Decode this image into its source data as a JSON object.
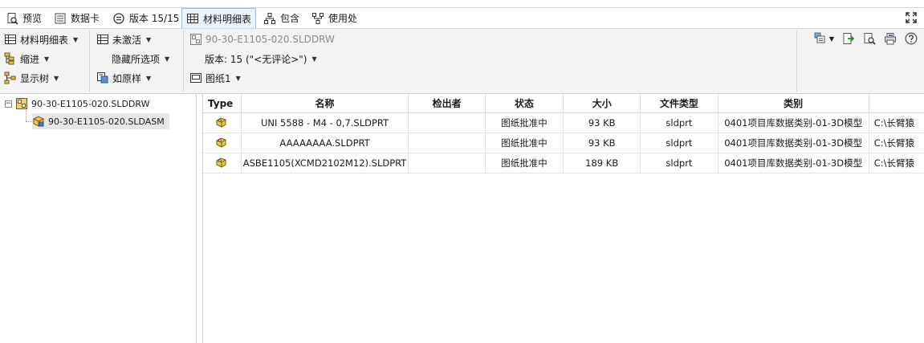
{
  "tabs": [
    {
      "label": "预览",
      "icon": "preview-icon"
    },
    {
      "label": "数据卡",
      "icon": "datacard-icon"
    },
    {
      "label": "版本 15/15",
      "icon": "version-icon"
    },
    {
      "label": "材料明细表",
      "icon": "bom-table-icon",
      "active": true
    },
    {
      "label": "包含",
      "icon": "contains-icon"
    },
    {
      "label": "使用处",
      "icon": "where-used-icon"
    }
  ],
  "toolbar": {
    "bom_label": "材料明细表",
    "indent_label": "缩进",
    "show_tree_label": "显示树",
    "inactive_label": "未激活",
    "hidden_options_label": "隐藏所选项",
    "as_built_label": "如原样",
    "file_name": "90-30-E1105-020.SLDDRW",
    "version_label": "版本: 15 (\"<无评论>\")",
    "sheet_label": "图纸1"
  },
  "tree": {
    "root": "90-30-E1105-020.SLDDRW",
    "child": "90-30-E1105-020.SLDASM"
  },
  "table": {
    "headers": {
      "type": "Type",
      "name": "名称",
      "checked_out_by": "检出者",
      "state": "状态",
      "size": "大小",
      "file_type": "文件类型",
      "category": "类别"
    },
    "rows": [
      {
        "name": "UNI 5588 - M4 - 0,7.SLDPRT",
        "checked_out_by": "",
        "state": "图纸批准中",
        "size": "93 KB",
        "file_type": "sldprt",
        "category": "0401项目库数据类别-01-3D模型",
        "path": "C:\\长臂猿"
      },
      {
        "name": "AAAAAAAA.SLDPRT",
        "checked_out_by": "",
        "state": "图纸批准中",
        "size": "93 KB",
        "file_type": "sldprt",
        "category": "0401项目库数据类别-01-3D模型",
        "path": "C:\\长臂猿"
      },
      {
        "name": "ASBE1105(XCMD2102M12).SLDPRT",
        "checked_out_by": "",
        "state": "图纸批准中",
        "size": "189 KB",
        "file_type": "sldprt",
        "category": "0401项目库数据类别-01-3D模型",
        "path": "C:\\长臂猿"
      }
    ]
  }
}
